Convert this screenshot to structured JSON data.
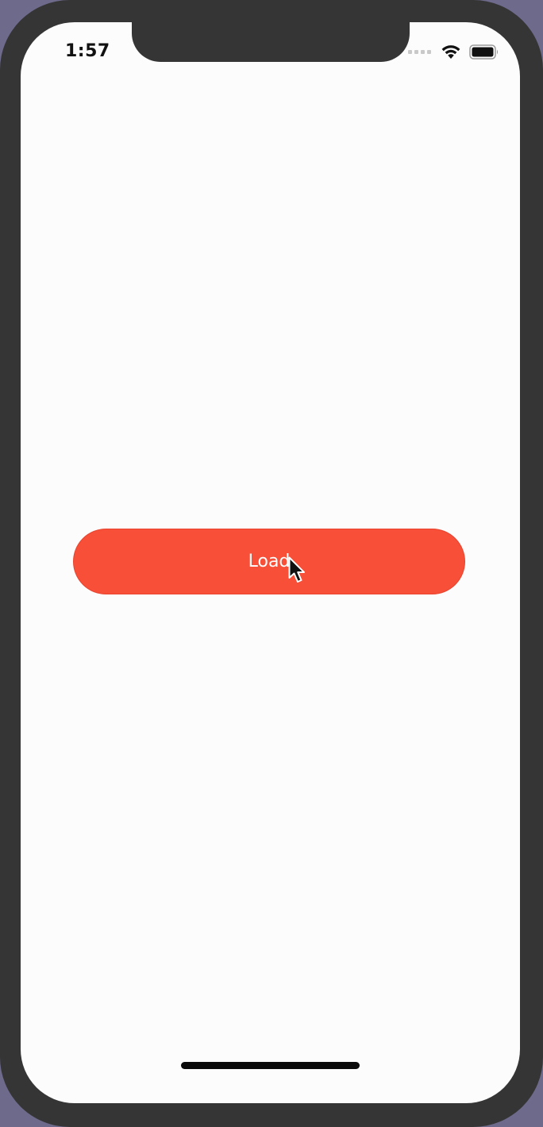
{
  "status_bar": {
    "time": "1:57"
  },
  "main": {
    "load_button_label": "Load"
  },
  "icons": {
    "wifi": "wifi-icon",
    "battery": "battery-icon",
    "cellular": "cellular-signal-icon",
    "cursor": "mouse-pointer-icon"
  },
  "colors": {
    "accent": "#f74f38",
    "screen_background": "#fcfcfc",
    "frame": "#353535"
  }
}
